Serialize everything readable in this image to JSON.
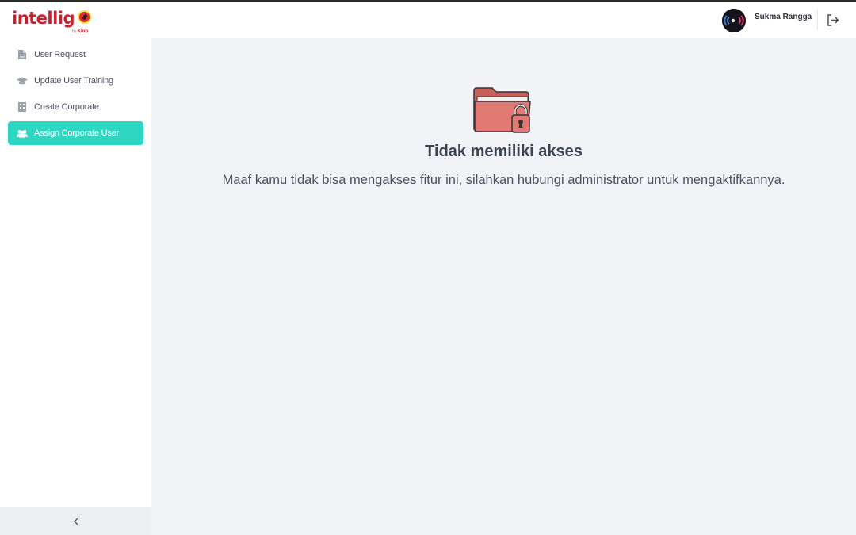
{
  "app": {
    "logo_text": "intellig",
    "logo_sub_prefix": "by",
    "logo_sub_brand": "Klob"
  },
  "sidebar": {
    "items": [
      {
        "label": "User Request",
        "icon": "document-icon",
        "active": false
      },
      {
        "label": "Update User Training",
        "icon": "graduation-cap-icon",
        "active": false
      },
      {
        "label": "Create Corporate",
        "icon": "building-icon",
        "active": false
      },
      {
        "label": "Assign Corporate User",
        "icon": "users-icon",
        "active": true
      }
    ],
    "collapse_icon": "chevron-left-icon"
  },
  "header": {
    "user_name": "Sukma Rangga",
    "user_sub": "-",
    "logout_icon": "logout-icon"
  },
  "main": {
    "title": "Tidak memiliki akses",
    "message": "Maaf kamu tidak bisa mengakses fitur ini, silahkan hubungi administrator untuk mengaktifkannya.",
    "illustration_icon": "locked-folder-icon"
  },
  "colors": {
    "accent": "#2fd6c2",
    "brand": "#c8202a",
    "folder": "#e07a72"
  }
}
